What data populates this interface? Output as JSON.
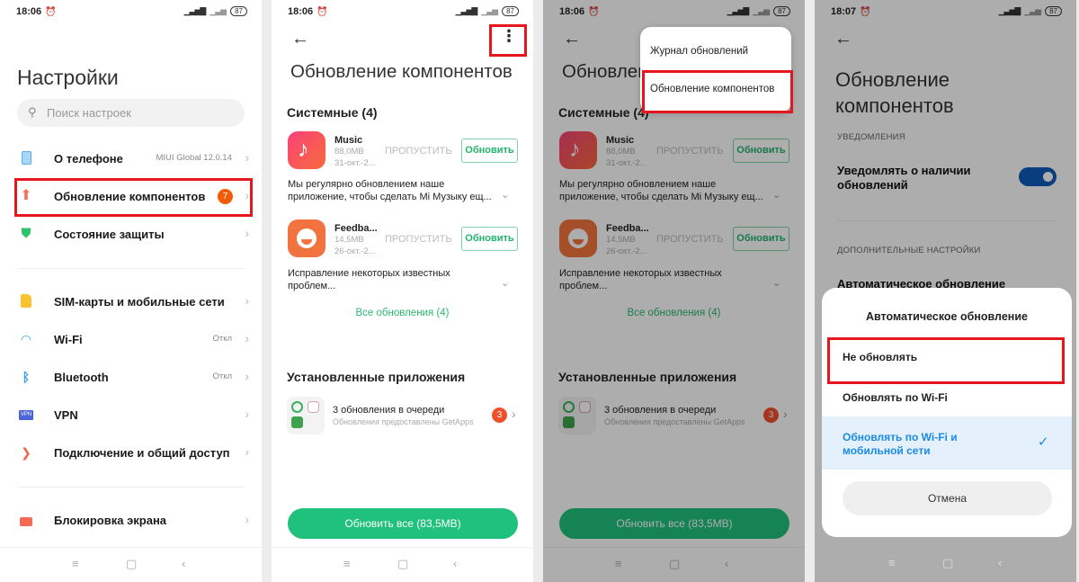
{
  "status_bars": [
    {
      "time": "18:06",
      "battery": "87"
    },
    {
      "time": "18:06",
      "battery": "87"
    },
    {
      "time": "18:06",
      "battery": "87"
    },
    {
      "time": "18:07",
      "battery": "87"
    }
  ],
  "settings": {
    "title": "Настройки",
    "search_placeholder": "Поиск настроек",
    "items": [
      {
        "label": "О телефоне",
        "value": "MIUI Global 12.0.14",
        "icon": "phone-icon"
      },
      {
        "label": "Обновление компонентов",
        "badge": "7",
        "icon": "arrow-up-icon"
      },
      {
        "label": "Состояние защиты",
        "icon": "shield-icon"
      },
      {
        "label": "SIM-карты и мобильные сети",
        "icon": "sim-icon"
      },
      {
        "label": "Wi-Fi",
        "value": "Откл",
        "icon": "wifi-icon"
      },
      {
        "label": "Bluetooth",
        "value": "Откл",
        "icon": "bluetooth-icon"
      },
      {
        "label": "VPN",
        "icon": "vpn-icon",
        "icon_text": "VPN"
      },
      {
        "label": "Подключение и общий доступ",
        "icon": "share-icon"
      },
      {
        "label": "Блокировка экрана",
        "icon": "lock-icon"
      }
    ]
  },
  "updates": {
    "title": "Обновление компонентов",
    "system_header": "Системные (4)",
    "apps": [
      {
        "name": "Music",
        "size": "88,0MB",
        "date": "31-окт.-2...",
        "skip": "ПРОПУСТИТЬ",
        "update": "Обновить",
        "desc": "Мы регулярно обновлением наше приложение, чтобы сделать Mi Музыку ещ..."
      },
      {
        "name": "Feedba...",
        "size": "14,5MB",
        "date": "26-окт.-2...",
        "skip": "ПРОПУСТИТЬ",
        "update": "Обновить",
        "desc": "Исправление некоторых известных проблем..."
      }
    ],
    "all_updates": "Все обновления (4)",
    "installed_header": "Установленные приложения",
    "queue_title": "3 обновления в очереди",
    "queue_subtitle": "Обновления предоставлены GetApps",
    "queue_badge": "3",
    "update_all": "Обновить все (83,5MB)"
  },
  "overflow_menu": {
    "items": [
      "Журнал обновлений",
      "Обновление компонентов"
    ]
  },
  "component_settings": {
    "title": "Обновление компонентов",
    "notifications_caption": "УВЕДОМЛЕНИЯ",
    "notify_label": "Уведомлять о наличии обновлений",
    "notify_enabled": true,
    "advanced_caption": "ДОПОЛНИТЕЛЬНЫЕ НАСТРОЙКИ",
    "auto_update_label": "Автоматическое обновление",
    "dialog": {
      "title": "Автоматическое обновление",
      "options": [
        "Не обновлять",
        "Обновлять по Wi-Fi",
        "Обновлять по Wi-Fi и мобильной сети"
      ],
      "selected": "Обновлять по Wi-Fi и мобильной сети",
      "cancel": "Отмена"
    }
  },
  "colors": {
    "highlight": "#e5161d",
    "green": "#1fc17c",
    "toggle": "#0d5cba",
    "selected_text": "#1a8ae5",
    "badge": "#f25c05"
  }
}
